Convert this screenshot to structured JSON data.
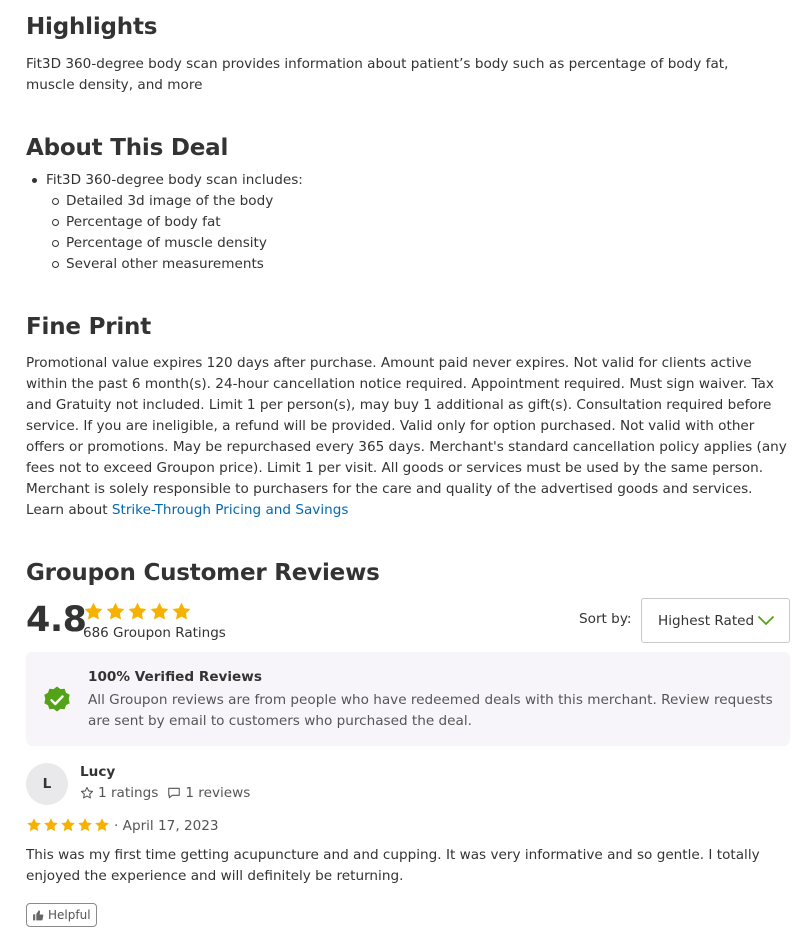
{
  "highlights": {
    "title": "Highlights",
    "text": "Fit3D 360-degree body scan provides information about patient’s body such as percentage of body fat, muscle density, and more"
  },
  "about": {
    "title": "About This Deal",
    "item": "Fit3D 360-degree body scan includes:",
    "subitems": [
      "Detailed 3d image of the body",
      "Percentage of body fat",
      "Percentage of muscle density",
      "Several other measurements"
    ]
  },
  "fine_print": {
    "title": "Fine Print",
    "text": "Promotional value expires 120 days after purchase. Amount paid never expires. Not valid for clients active within the past 6 month(s). 24-hour cancellation notice required. Appointment required. Must sign waiver. Tax and Gratuity not included. Limit 1 per person(s), may buy 1 additional as gift(s). Consultation required before service. If you are ineligible, a refund will be provided. Valid only for option purchased. Not valid with other offers or promotions. May be repurchased every 365 days. Merchant's standard cancellation policy applies (any fees not to exceed Groupon price). Limit 1 per visit. All goods or services must be used by the same person. Merchant is solely responsible to purchasers for the care and quality of the advertised goods and services. Learn about ",
    "link_text": "Strike-Through Pricing and Savings"
  },
  "reviews": {
    "title": "Groupon Customer Reviews",
    "rating": "4.8",
    "rating_count": "686 Groupon Ratings",
    "stars": 5,
    "sort_label": "Sort by:",
    "sort_value": "Highest Rated",
    "verified_title": "100% Verified Reviews",
    "verified_text": "All Groupon reviews are from people who have redeemed deals with this merchant. Review requests are sent by email to customers who purchased the deal.",
    "items": [
      {
        "avatar_letter": "L",
        "name": "Lucy",
        "ratings": "1 ratings",
        "review_count": "1 reviews",
        "stars": 5,
        "date": "· April 17, 2023",
        "text": "This was my first time getting acupuncture and and cupping. It was very informative and so gentle. I totally enjoyed the experience and will definitely be returning.",
        "helpful_label": "Helpful"
      }
    ]
  },
  "colors": {
    "star": "#f7b100",
    "link": "#0668ac",
    "verified_green": "#53a318",
    "chevron": "#53a318",
    "verified_bg": "#f7f5fa"
  },
  "icons": {
    "star": "star-icon",
    "verified": "verified-check-icon",
    "chevron": "chevron-down-icon",
    "rating_outline": "star-outline-icon",
    "comment": "comment-icon",
    "thumbs_up": "thumbs-up-icon"
  }
}
